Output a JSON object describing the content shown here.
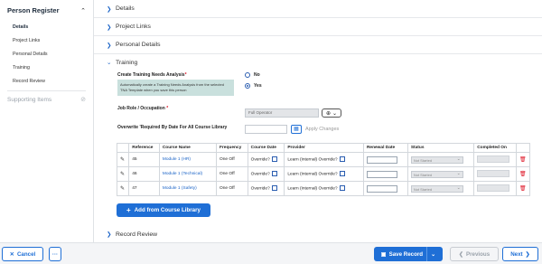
{
  "sidebar": {
    "title": "Person Register",
    "items": [
      {
        "label": "Details",
        "active": true
      },
      {
        "label": "Project Links",
        "active": false
      },
      {
        "label": "Personal Details",
        "active": false
      },
      {
        "label": "Training",
        "active": false
      },
      {
        "label": "Record Review",
        "active": false
      }
    ],
    "supporting": "Supporting Items"
  },
  "sections": {
    "details": "Details",
    "project_links": "Project Links",
    "personal_details": "Personal Details",
    "training": "Training",
    "record_review": "Record Review"
  },
  "training": {
    "tna_label": "Create Training Needs Analysis",
    "tna_info": "Automatically create a Training Needs Analysis from the selected TNA Template when you save this person",
    "radio_no": "No",
    "radio_yes": "Yes",
    "job_role_label": "Job Role / Occupation",
    "job_role_value": "Full Operator",
    "overwrite_label": "Overwrite 'Required By Date For All Course Library",
    "apply_changes": "Apply Changes",
    "add_button": "Add from Course Library"
  },
  "table": {
    "headers": [
      "",
      "Reference",
      "Course Name",
      "Frequency",
      "Course Date",
      "Provider",
      "Renewal Date",
      "Status",
      "Completed On",
      ""
    ],
    "rows": [
      {
        "reference": "45",
        "course": "Module 1 (HR)",
        "frequency": "One Off",
        "course_date": "Override?",
        "provider": "Learn (Internal) Override?",
        "status": "Not Started"
      },
      {
        "reference": "46",
        "course": "Module 1 (Technical)",
        "frequency": "One Off",
        "course_date": "Override?",
        "provider": "Learn (Internal) Override?",
        "status": "Not Started"
      },
      {
        "reference": "47",
        "course": "Module 1 (Safety)",
        "frequency": "One Off",
        "course_date": "Override?",
        "provider": "Learn (Internal) Override?",
        "status": "Not Started"
      }
    ]
  },
  "footer": {
    "cancel": "Cancel",
    "more": "···",
    "save": "Save Record",
    "previous": "Previous",
    "next": "Next"
  },
  "colors": {
    "accent": "#1f6fd6",
    "info_bg": "#c9e0dd",
    "danger": "#dd1122"
  }
}
